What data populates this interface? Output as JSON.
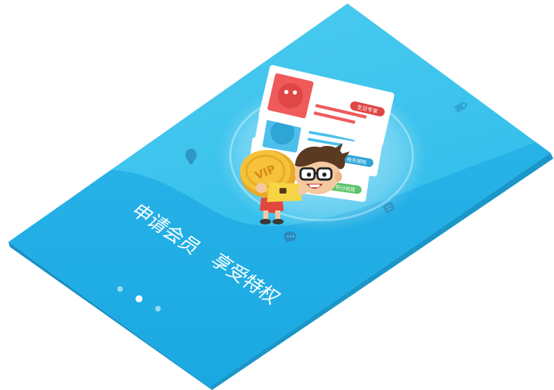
{
  "onboarding": {
    "headline": "申请会员",
    "subheadline": "享受特权",
    "card_tags": [
      "生日专享",
      "抢先预购",
      "积分抵现"
    ],
    "coin_text": "VIP",
    "pager": {
      "page_count": 3,
      "active_index": 1
    },
    "colors": {
      "screen_top": "#46c8ee",
      "screen_bottom": "#1cb0e6",
      "card_red": "#ef5b5b",
      "card_blue": "#4cc0ea",
      "card_green": "#5dc46a",
      "coin_gold": "#f5c23a",
      "shirt_yellow": "#f7d444",
      "shorts_red": "#e2463e"
    },
    "icons": [
      "tag-icon",
      "balloon-icon",
      "document-icon",
      "chat-icon",
      "vip-coin-icon"
    ]
  }
}
